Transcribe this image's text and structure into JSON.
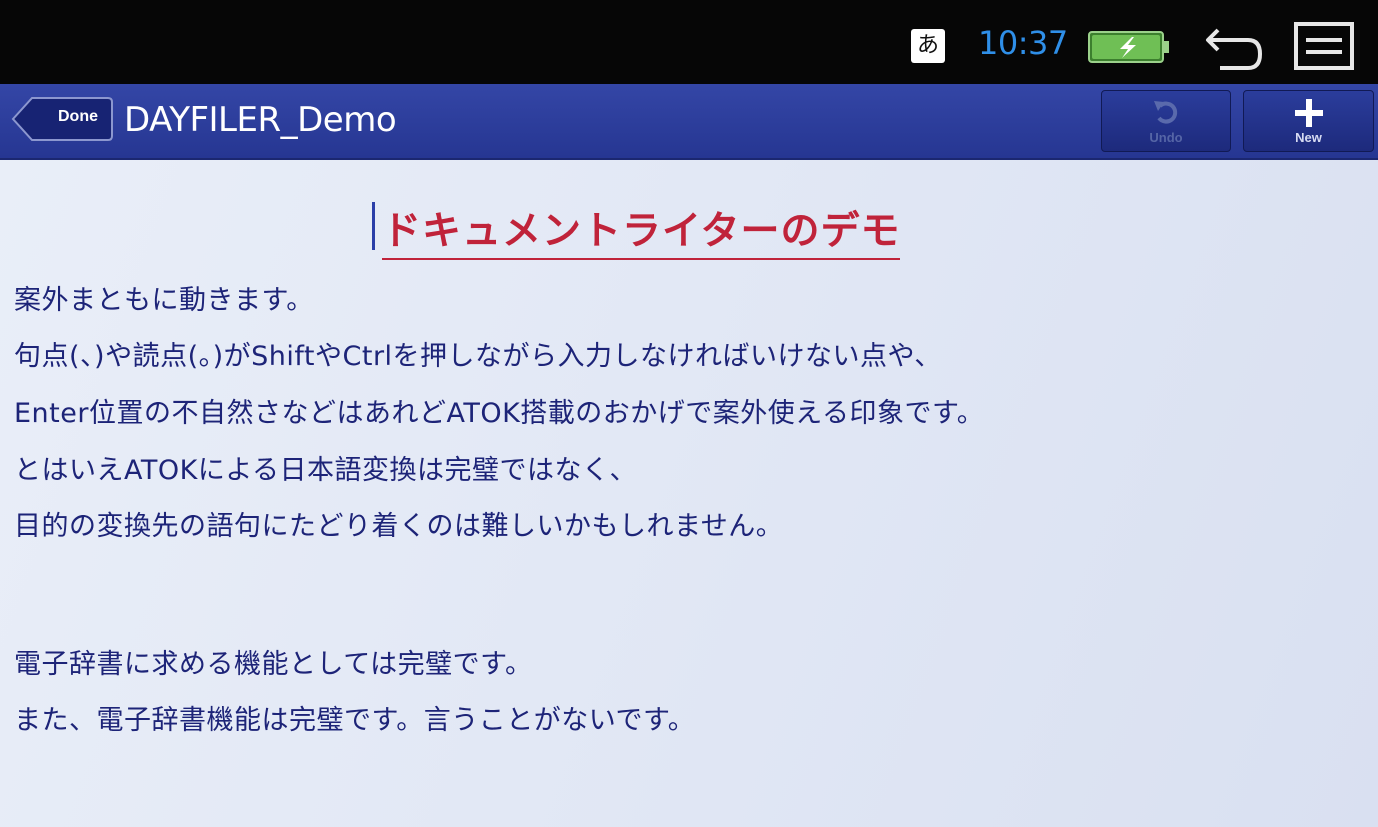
{
  "status_bar": {
    "ime_indicator": "あ",
    "time": "10:37",
    "icons": [
      "battery-icon",
      "back-icon",
      "menu-icon"
    ],
    "clock_color": "#2f8fe8"
  },
  "app_bar": {
    "done_label": "Done",
    "title": "DAYFILER_Demo",
    "undo_label": "Undo",
    "new_label": "New",
    "background_color": "#2d3f9e"
  },
  "document": {
    "title": "ドキュメントライターのデモ",
    "title_color": "#c0233a",
    "text_color": "#1d2478",
    "lines": [
      "案外まともに動きます。",
      "句点(、)や読点(。)がShiftやCtrlを押しながら入力しなければいけない点や、",
      "Enter位置の不自然さなどはあれどATOK搭載のおかげで案外使える印象です。",
      "とはいえATOKによる日本語変換は完璧ではなく、",
      "目的の変換先の語句にたどり着くのは難しいかもしれません。",
      "電子辞書に求める機能としては完璧です。",
      "また、電子辞書機能は完璧です。言うことがないです。"
    ]
  }
}
